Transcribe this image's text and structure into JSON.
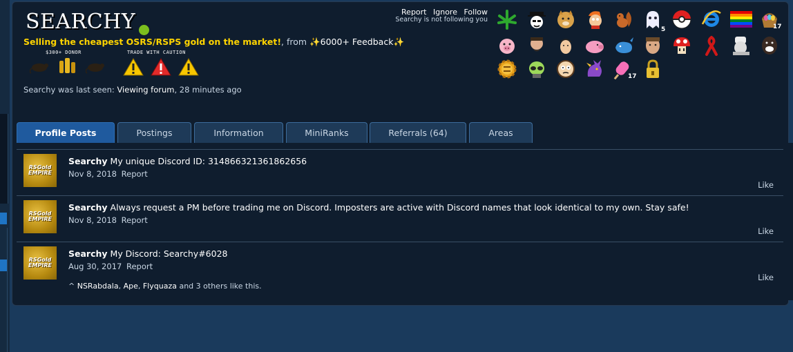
{
  "profile": {
    "username": "SEARCHY",
    "tagline_highlight": "Selling the cheapest OSRS/RSPS gold on the market!",
    "tagline_from": ", from",
    "feedback": "6000+ Feedback",
    "sparkle": "✨",
    "caption_donor": "$300+ DONOR",
    "caption_trade": "TRADE WITH CAUTION",
    "last_seen_prefix": "Searchy was last seen:",
    "last_seen_action": "Viewing forum",
    "last_seen_time": ", 28 minutes ago",
    "status_color": "#7cbf1e"
  },
  "actions": {
    "report": "Report",
    "ignore": "Ignore",
    "follow": "Follow",
    "following_note": "Searchy is not following you"
  },
  "donor_icons": [
    "rat-icon",
    "gold-bags-icon",
    "rat-icon"
  ],
  "warning_icons": [
    "warning-yellow-icon",
    "warning-red-icon",
    "warning-yellow-icon"
  ],
  "trophy_badges": {
    "ghost": "5",
    "basket": "17",
    "popsicle": "17"
  },
  "tabs": [
    {
      "label": "Profile Posts",
      "active": true
    },
    {
      "label": "Postings"
    },
    {
      "label": "Information"
    },
    {
      "label": "MiniRanks"
    },
    {
      "label": "Referrals (64)"
    },
    {
      "label": "Areas"
    }
  ],
  "posts": [
    {
      "author": "Searchy",
      "text": "My unique Discord ID: 314866321361862656",
      "date": "Nov 8, 2018",
      "report": "Report",
      "like": "Like"
    },
    {
      "author": "Searchy",
      "text": "Always request a PM before trading me on Discord. Imposters are active with Discord names that look identical to my own. Stay safe!",
      "date": "Nov 8, 2018",
      "report": "Report",
      "like": "Like"
    },
    {
      "author": "Searchy",
      "text": "My Discord: Searchy#6028",
      "date": "Aug 30, 2017",
      "report": "Report",
      "like": "Like",
      "likes": {
        "prefix": "^",
        "names": [
          "NSRabdala",
          "Ape",
          "Flyquaza"
        ],
        "suffix": "and 3 others like this."
      }
    }
  ],
  "avatar": {
    "line1": "RSGold",
    "line2": "EMPIRE"
  },
  "colors": {
    "accent": "#1f5a9e",
    "highlight": "#ffd400",
    "background": "#0f1d2e"
  }
}
